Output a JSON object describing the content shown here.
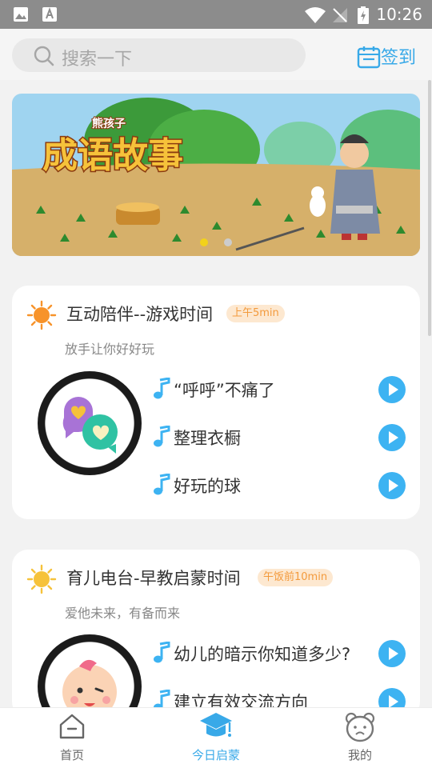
{
  "status_bar": {
    "time": "10:26"
  },
  "header": {
    "search_placeholder": "搜索一下",
    "checkin_label": "签到"
  },
  "banner": {
    "title": "成语故事",
    "brand": "熊孩子"
  },
  "sections": [
    {
      "title": "互动陪伴--游戏时间",
      "tag": "上午5min",
      "subtitle": "放手让你好好玩",
      "tracks": [
        "“呼呼”不痛了",
        "整理衣橱",
        "好玩的球"
      ]
    },
    {
      "title": "育儿电台-早教启蒙时间",
      "tag": "午饭前10min",
      "subtitle": "爱他未来，有备而来",
      "tracks": [
        "幼儿的暗示你知道多少?",
        "建立有效交流方向"
      ]
    }
  ],
  "tabs": [
    {
      "label": "首页",
      "icon": "home-icon"
    },
    {
      "label": "今日启蒙",
      "icon": "graduation-cap-icon"
    },
    {
      "label": "我的",
      "icon": "bear-face-icon"
    }
  ],
  "colors": {
    "accent": "#38a9e8",
    "play": "#3db3f2",
    "tag_bg": "#fde8d0",
    "tag_text": "#f39a3c"
  }
}
